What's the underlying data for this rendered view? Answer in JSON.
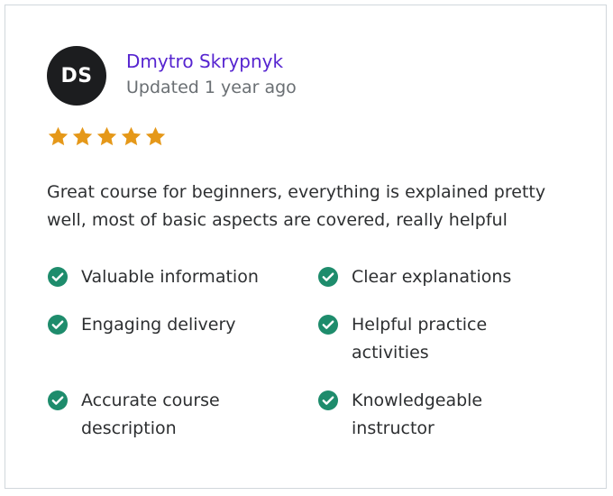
{
  "review": {
    "avatar_initials": "DS",
    "user_name": "Dmytro Skrypnyk",
    "updated": "Updated 1 year ago",
    "rating": 5,
    "rating_max": 5,
    "text": "Great course for beginners, everything is explained pretty well, most of basic aspects are covered, really helpful",
    "tags": [
      {
        "label": "Valuable information"
      },
      {
        "label": "Clear explanations"
      },
      {
        "label": "Engaging delivery"
      },
      {
        "label": "Helpful practice activities"
      },
      {
        "label": "Accurate course description"
      },
      {
        "label": "Knowledgeable instructor"
      }
    ]
  },
  "colors": {
    "name_link": "#5624d0",
    "muted_text": "#6a6f73",
    "star": "#e59819",
    "check": "#1e8c6c",
    "avatar_bg": "#1c1d1f",
    "border": "#d1d7dc"
  },
  "icons": {
    "star": "star-icon",
    "check": "check-circle-icon"
  }
}
